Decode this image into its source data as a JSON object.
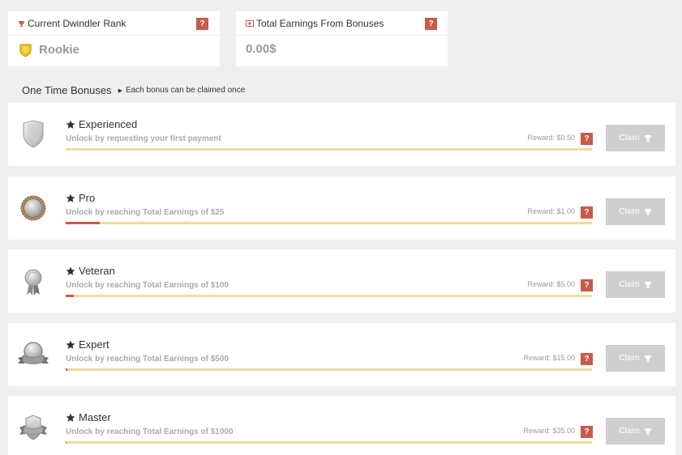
{
  "stats": {
    "rank": {
      "label": "Current Dwindler Rank",
      "value": "Rookie",
      "help": "?"
    },
    "earnings": {
      "label": "Total Earnings From Bonuses",
      "value": "0.00$",
      "help": "?"
    }
  },
  "section": {
    "title": "One Time Bonuses",
    "subtitle": "Each bonus can be claimed once"
  },
  "bonuses": [
    {
      "name": "Experienced",
      "desc": "Unlock by requesting your first payment",
      "reward": "Reward: $0.50",
      "progress": 0,
      "claim": "Claim",
      "help": "?"
    },
    {
      "name": "Pro",
      "desc": "Unlock by reaching Total Earnings of $25",
      "reward": "Reward: $1.00",
      "progress": 0.065,
      "claim": "Claim",
      "help": "?"
    },
    {
      "name": "Veteran",
      "desc": "Unlock by reaching Total Earnings of $100",
      "reward": "Reward: $5.00",
      "progress": 0.016,
      "claim": "Claim",
      "help": "?"
    },
    {
      "name": "Expert",
      "desc": "Unlock by reaching Total Earnings of $500",
      "reward": "Reward: $15.00",
      "progress": 0.003,
      "claim": "Claim",
      "help": "?"
    },
    {
      "name": "Master",
      "desc": "Unlock by reaching Total Earnings of $1000",
      "reward": "Reward: $35.00",
      "progress": 0.0016,
      "claim": "Claim",
      "help": "?"
    }
  ],
  "colors": {
    "accent": "#c75b4a",
    "track": "#f0dca0",
    "claim_disabled": "#cfcfcf",
    "rank_badge": "#f0c21b"
  }
}
